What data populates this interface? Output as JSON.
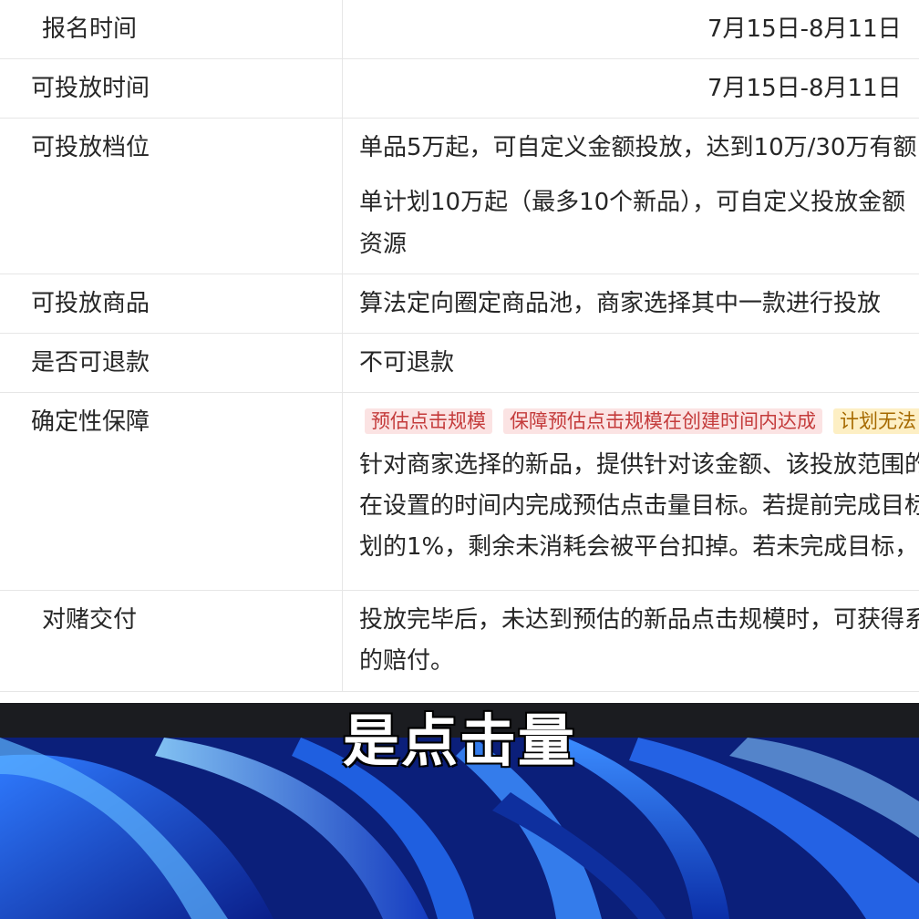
{
  "table": {
    "rows": [
      {
        "label": "报名时间",
        "value": "7月15日-8月11日"
      },
      {
        "label": "可投放时间",
        "value": "7月15日-8月11日"
      },
      {
        "label": "可投放档位",
        "lines": [
          "单品5万起，可自定义金额投放，达到10万/30万有额",
          "单计划10万起（最多10个新品），可自定义投放金额",
          "资源"
        ]
      },
      {
        "label": "可投放商品",
        "value": "算法定向圈定商品池，商家选择其中一款进行投放"
      },
      {
        "label": "是否可退款",
        "value": "不可退款"
      },
      {
        "label": "确定性保障",
        "tags": [
          "预估点击规模",
          "保障预估点击规模在创建时间内达成",
          "计划无法"
        ],
        "lines": [
          "针对商家选择的新品，提供针对该金额、该投放范围的",
          "在设置的时间内完成预估点击量目标。若提前完成目标",
          "划的1%，剩余未消耗会被平台扣掉。若未完成目标，"
        ]
      },
      {
        "label": "对赌交付",
        "lines": [
          "投放完毕后，未达到预估的新品点击规模时，可获得系",
          "的赔付。"
        ]
      }
    ]
  },
  "caption": "是点击量",
  "colors": {
    "tag_red_bg": "#fbe3e3",
    "tag_orange_bg": "#fdefc4",
    "wallpaper": "#0a1a6b"
  }
}
